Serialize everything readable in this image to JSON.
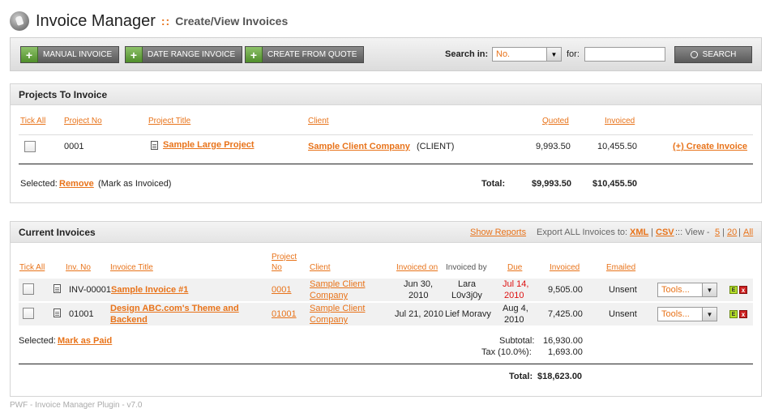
{
  "header": {
    "app_title": "Invoice Manager",
    "separator": "::",
    "page_subtitle": "Create/View Invoices"
  },
  "toolbar": {
    "manual_invoice": "MANUAL INVOICE",
    "date_range_invoice": "DATE RANGE INVOICE",
    "create_from_quote": "CREATE FROM QUOTE",
    "search_in_label": "Search in:",
    "search_in_value": "No.",
    "for_label": "for:",
    "search_value": "",
    "search_button": "SEARCH"
  },
  "projects": {
    "title": "Projects To Invoice",
    "columns": {
      "tick_all": "Tick All",
      "project_no": "Project No",
      "project_title": "Project Title",
      "client": "Client",
      "quoted": "Quoted",
      "invoiced": "Invoiced"
    },
    "rows": [
      {
        "project_no": "0001",
        "title": "Sample Large Project",
        "client": "Sample Client Company",
        "client_tag": "(CLIENT)",
        "quoted": "9,993.50",
        "invoiced": "10,455.50",
        "action": "(+) Create Invoice"
      }
    ],
    "selected_label": "Selected:",
    "remove_link": "Remove",
    "remove_note": "(Mark as Invoiced)",
    "total_label": "Total:",
    "total_quoted": "$9,993.50",
    "total_invoiced": "$10,455.50"
  },
  "invoices": {
    "title": "Current Invoices",
    "show_reports": "Show Reports",
    "export_label": "Export ALL Invoices to:",
    "export_xml": "XML",
    "export_sep": "|",
    "export_csv": "CSV",
    "view_label": "::: View -",
    "view_5": "5",
    "view_20": "20",
    "view_all": "All",
    "columns": {
      "tick_all": "Tick All",
      "inv_no": "Inv. No",
      "invoice_title": "Invoice Title",
      "project_no_1": "Project",
      "project_no_2": "No",
      "client": "Client",
      "invoiced_on": "Invoiced on",
      "invoiced_by": "Invoiced by",
      "due": "Due",
      "invoiced": "Invoiced",
      "emailed": "Emailed"
    },
    "rows": [
      {
        "inv_no": "INV-00001",
        "title_1": "Sample Invoice #1",
        "title_2": "",
        "project_no": "0001",
        "client_1": "Sample Client",
        "client_2": "Company",
        "invoiced_on": "Jun 30,",
        "invoiced_on_2": "2010",
        "invoiced_by_1": "Lara",
        "invoiced_by_2": "L0v3j0y",
        "due_1": "Jul 14,",
        "due_2": "2010",
        "amount": "9,505.00",
        "emailed": "Unsent",
        "tools": "Tools..."
      },
      {
        "inv_no": "01001",
        "title_1": "Design ABC.com's Theme and",
        "title_2": "Backend",
        "project_no": "01001",
        "client_1": "Sample Client",
        "client_2": "Company",
        "invoiced_on": "Jul 21, 2010",
        "invoiced_on_2": "",
        "invoiced_by_1": "Lief Moravy",
        "invoiced_by_2": "",
        "due_1": "Aug 4,",
        "due_2": "2010",
        "amount": "7,425.00",
        "emailed": "Unsent",
        "tools": "Tools..."
      }
    ],
    "selected_label": "Selected:",
    "mark_paid": "Mark as Paid",
    "subtotal_label": "Subtotal:",
    "subtotal": "16,930.00",
    "tax_label": "Tax (10.0%):",
    "tax": "1,693.00",
    "total_label": "Total:",
    "total": "$18,623.00",
    "email_btn": "E",
    "delete_btn": "x"
  },
  "footer": "PWF - Invoice Manager Plugin - v7.0",
  "colors": {
    "accent": "#e8731a",
    "due_red": "#dd1111",
    "plus_green": "#5a9a32"
  }
}
